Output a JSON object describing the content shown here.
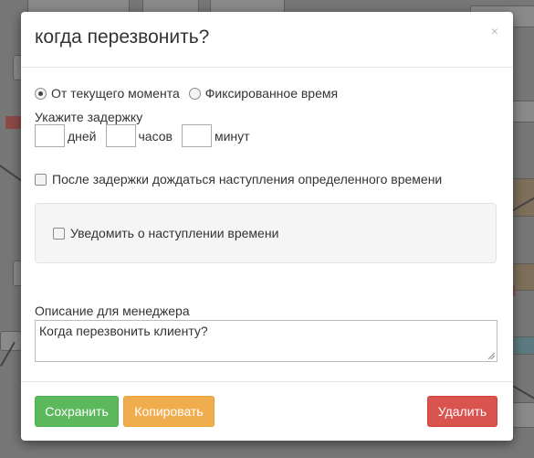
{
  "dialog": {
    "title": "когда перезвонить?",
    "close_symbol": "×"
  },
  "timing_mode": {
    "options": [
      {
        "label": "От текущего момента",
        "selected": true
      },
      {
        "label": "Фиксированное время",
        "selected": false
      }
    ]
  },
  "delay": {
    "label": "Укажите задержку",
    "days": {
      "value": "",
      "unit": "дней"
    },
    "hours": {
      "value": "",
      "unit": "часов"
    },
    "minutes": {
      "value": "",
      "unit": "минут"
    }
  },
  "wait_after_delay": {
    "label": "После задержки дождаться наступления определенного времени",
    "checked": false
  },
  "notify": {
    "label": "Уведомить о наступлении времени",
    "checked": false
  },
  "manager_description": {
    "label": "Описание для менеджера",
    "value": "Когда перезвонить клиенту?"
  },
  "footer": {
    "save_label": "Сохранить",
    "copy_label": "Копировать",
    "delete_label": "Удалить"
  },
  "colors": {
    "save": "#5cb85c",
    "copy": "#f0ad4e",
    "delete": "#d9534f",
    "overlay": "#777777"
  }
}
